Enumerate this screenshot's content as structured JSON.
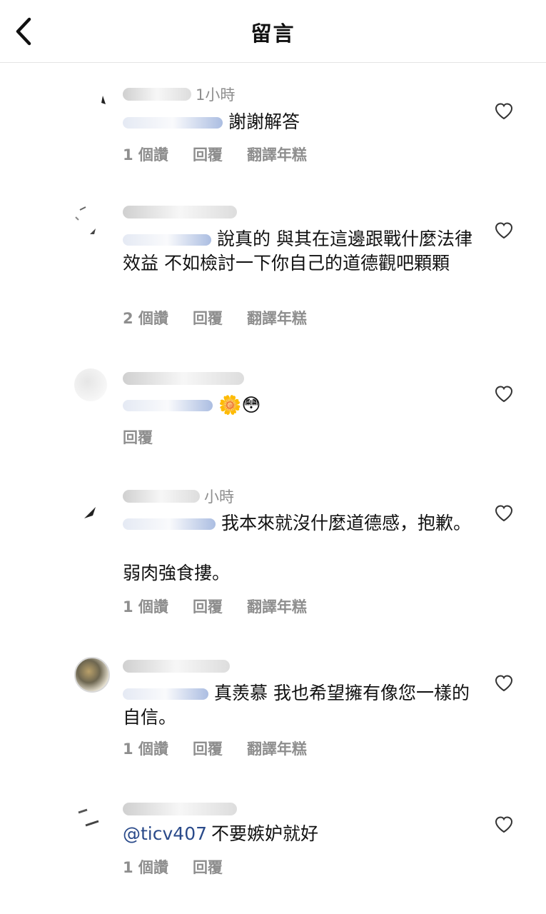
{
  "header": {
    "title": "留言"
  },
  "comments": [
    {
      "time": "1小時",
      "mention_prefix": "",
      "text": "謝謝解答",
      "likes": "1 個讚",
      "reply": "回覆",
      "translate": "翻譯年糕"
    },
    {
      "time": "",
      "mention_prefix": "",
      "text": "說真的 與其在這邊跟戰什麼法律效益 不如檢討一下你自己的道德觀吧顆顆",
      "likes": "2 個讚",
      "reply": "回覆",
      "translate": "翻譯年糕"
    },
    {
      "time": "",
      "mention_prefix": "",
      "text": "🌼😳",
      "likes": "",
      "reply": "回覆",
      "translate": ""
    },
    {
      "time": "小時",
      "mention_prefix": "",
      "text": "我本來就沒什麼道德感，抱歉。",
      "text2": "弱肉強食摟。",
      "likes": "1 個讚",
      "reply": "回覆",
      "translate": "翻譯年糕"
    },
    {
      "time": "",
      "mention_prefix": "",
      "text": "真羨慕 我也希望擁有像您一樣的自信。",
      "likes": "1 個讚",
      "reply": "回覆",
      "translate": "翻譯年糕"
    },
    {
      "time": "",
      "mention_prefix": "@ticv407",
      "text": "不要嫉妒就好",
      "likes": "1 個讚",
      "reply": "回覆",
      "translate": ""
    }
  ],
  "icons": {
    "back": "chevron-left-icon",
    "like": "heart-outline-icon"
  },
  "colors": {
    "text": "#111111",
    "muted": "#8e8e8e",
    "divider": "#e4e4e4",
    "mention": "#2a4a8a"
  }
}
